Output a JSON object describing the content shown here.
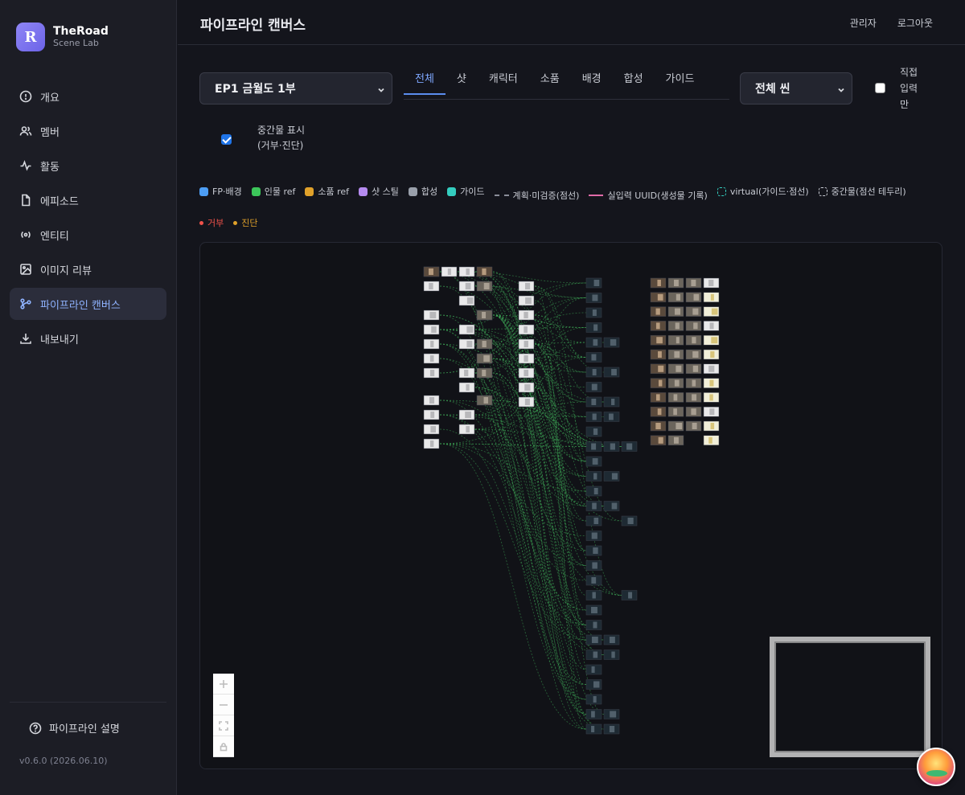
{
  "brand": {
    "logo_letter": "R",
    "name": "TheRoad",
    "subtitle": "Scene Lab"
  },
  "sidebar": {
    "items": [
      {
        "label": "개요",
        "icon": "info-circle-icon"
      },
      {
        "label": "멤버",
        "icon": "users-icon"
      },
      {
        "label": "활동",
        "icon": "activity-icon"
      },
      {
        "label": "에피소드",
        "icon": "file-icon"
      },
      {
        "label": "엔티티",
        "icon": "radio-icon"
      },
      {
        "label": "이미지 리뷰",
        "icon": "image-icon"
      },
      {
        "label": "파이프라인 캔버스",
        "icon": "git-branch-icon",
        "active": true
      },
      {
        "label": "내보내기",
        "icon": "download-icon"
      }
    ],
    "help_label": "파이프라인 설명",
    "version": "v0.6.0 (2026.06.10)"
  },
  "header": {
    "title": "파이프라인 캔버스",
    "admin": "관리자",
    "logout": "로그아웃"
  },
  "controls": {
    "episode": "EP1 금월도 1부",
    "scene": "전체 씬",
    "tabs": [
      "전체",
      "샷",
      "캐릭터",
      "소품",
      "배경",
      "합성",
      "가이드"
    ],
    "active_tab": "전체",
    "direct_only": {
      "label": "직접 입력 만",
      "checked": false
    },
    "show_intermediate": {
      "label_line1": "중간물 표시",
      "label_line2": "(거부·진단)",
      "checked": true
    }
  },
  "legend": [
    {
      "label": "FP·배경",
      "kind": "swatch",
      "color": "#4d9ef5"
    },
    {
      "label": "인물 ref",
      "kind": "swatch",
      "color": "#3cc65a"
    },
    {
      "label": "소품 ref",
      "kind": "swatch",
      "color": "#e0a12a"
    },
    {
      "label": "샷 스틸",
      "kind": "swatch",
      "color": "#b58bef"
    },
    {
      "label": "합성",
      "kind": "swatch",
      "color": "#9aa0ab"
    },
    {
      "label": "가이드",
      "kind": "swatch",
      "color": "#34cdbf"
    },
    {
      "label": "계획·미검증(점선)",
      "kind": "dash"
    },
    {
      "label": "실입력 UUID(생성물 기록)",
      "kind": "solid"
    },
    {
      "label": "virtual(가이드·점선)",
      "kind": "ring",
      "color": "#34cdbf"
    },
    {
      "label": "중간물(점선 테두리)",
      "kind": "ring",
      "color": "#c9ccd4"
    },
    {
      "label": "거부",
      "kind": "dot",
      "color": "#f0524a"
    },
    {
      "label": "진단",
      "kind": "dot",
      "color": "#e0a12a"
    }
  ],
  "colors": {
    "accent": "#7fa8ff",
    "edge": "#3fae5a"
  }
}
